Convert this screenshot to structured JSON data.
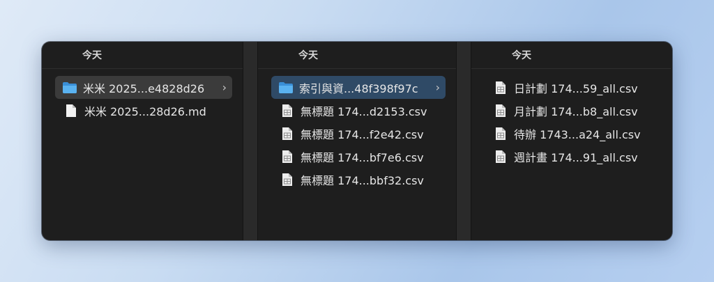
{
  "columns": [
    {
      "header": "今天",
      "items": [
        {
          "icon": "folder-icon",
          "label": "米米 2025...e4828d26",
          "selected": "gray",
          "chevron": "›"
        },
        {
          "icon": "document-icon",
          "label": "米米 2025...28d26.md"
        }
      ]
    },
    {
      "header": "今天",
      "items": [
        {
          "icon": "folder-icon",
          "label": "索引與資...48f398f97c",
          "selected": "blue",
          "chevron": "›"
        },
        {
          "icon": "csv-file-icon",
          "label": "無標題 174...d2153.csv"
        },
        {
          "icon": "csv-file-icon",
          "label": "無標題 174...f2e42.csv"
        },
        {
          "icon": "csv-file-icon",
          "label": "無標題 174...bf7e6.csv"
        },
        {
          "icon": "csv-file-icon",
          "label": "無標題 174...bbf32.csv"
        }
      ]
    },
    {
      "header": "今天",
      "items": [
        {
          "icon": "csv-file-icon",
          "label": "日計劃 174...59_all.csv"
        },
        {
          "icon": "csv-file-icon",
          "label": "月計劃 174...b8_all.csv"
        },
        {
          "icon": "csv-file-icon",
          "label": "待辦 1743...a24_all.csv"
        },
        {
          "icon": "csv-file-icon",
          "label": "週計畫 174...91_all.csv"
        }
      ]
    }
  ],
  "colors": {
    "folder": "#4aa3e6",
    "selection_gray": "#3b3b3b",
    "selection_blue": "#2f4a66",
    "window_bg": "#1e1e1e"
  }
}
